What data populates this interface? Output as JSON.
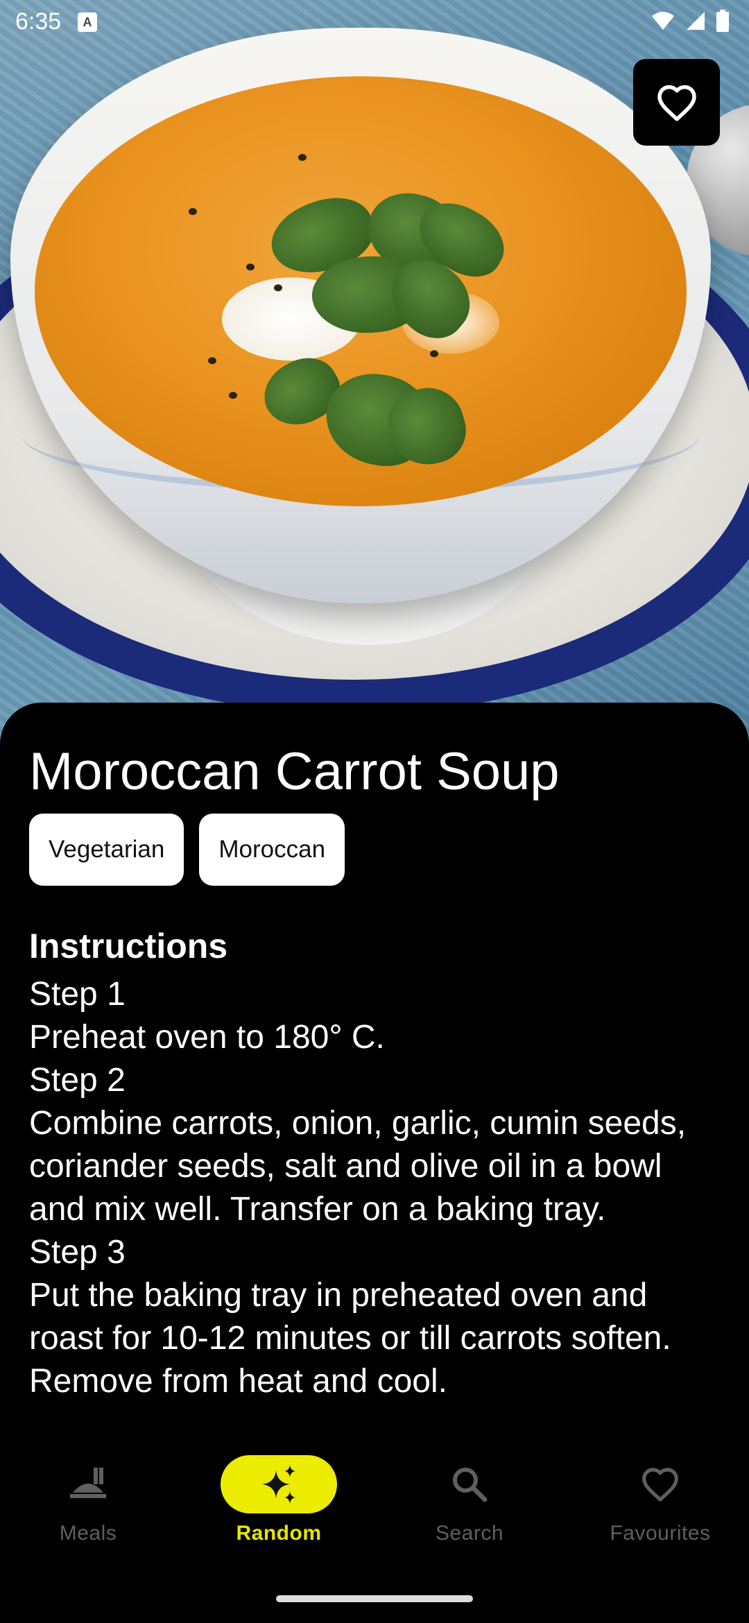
{
  "status_bar": {
    "time": "6:35",
    "notification_letter": "A",
    "icons": [
      "wifi-icon",
      "signal-icon",
      "battery-icon"
    ]
  },
  "hero": {
    "image_subject": "bowl of carrot soup with cilantro",
    "favourite_icon": "heart-outline-icon"
  },
  "meal": {
    "title": "Moroccan Carrot Soup",
    "tags": [
      "Vegetarian",
      "Moroccan"
    ],
    "instructions_heading": "Instructions",
    "instructions_text": "Step 1\nPreheat oven to 180° C.\nStep 2\nCombine carrots, onion, garlic, cumin seeds, coriander seeds, salt and olive oil in a bowl and mix well. Transfer on a baking tray.\nStep 3\nPut the baking tray in preheated oven and roast for 10-12 minutes or till carrots soften. Remove from heat and cool."
  },
  "bottom_nav": {
    "items": [
      {
        "label": "Meals",
        "icon": "meals-icon",
        "active": false
      },
      {
        "label": "Random",
        "icon": "sparkle-icon",
        "active": true
      },
      {
        "label": "Search",
        "icon": "search-icon",
        "active": false
      },
      {
        "label": "Favourites",
        "icon": "heart-outline-icon",
        "active": false
      }
    ]
  },
  "colors": {
    "accent": "#ecec00",
    "background": "#000000",
    "chip_background": "#ffffff",
    "inactive_nav": "#5f5f5f"
  }
}
